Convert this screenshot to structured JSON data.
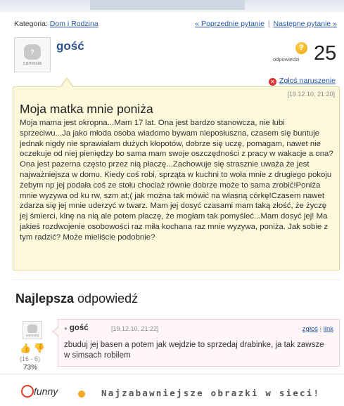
{
  "breadcrumb": {
    "prefix": "Kategoria:",
    "category": "Dom i Rodzina"
  },
  "nav": {
    "prev": "« Poprzednie pytanie",
    "separator": "|",
    "next": "Następne pytanie »"
  },
  "question": {
    "avatar_label": "samosia",
    "author": "gość",
    "answers_label": "odpowiedzi",
    "answers_count": "25",
    "report_label": "Zgłoś naruszenie",
    "date": "[19.12.10, 21:20]",
    "title": "Moja matka mnie poniża",
    "body": "Moja mama jest okropna...Mam 17 lat. Ona jest bardzo stanowcza, nie lubi sprzeciwu...Ja jako młoda osoba wiadomo bywam nieposłuszna, czasem się buntuje jednak nigdy nie sprawiałam dużych kłopotów, dobrze się uczę, pomagam, nawet nie oczekuje od niej pieniędzy bo sama mam swoje oszczędności z pracy w wakacje a ona? Ona jest pazerna często przez nią płaczę...Zachowuje się strasznie uważa że jest najważniejsza w domu. Kiedy coś robi, sprząta w kuchni to woła mnie z drugiego pokoju żebym np jej podała coś ze stołu chociaż równie dobrze może to sama zrobić!Poniża mnie wyzywa od ku rw, szm at;( jak można tak mówić na własną córkę!Czasem nawet zdarza się jej mnie uderzyć w twarz. Mam jej dosyć czasami mam taką złość, że życzę jej śmierci, klnę na nią ale potem płaczę, że mogłam tak pomyśleć...Mam dosyć jej! Ma jakieś rozdwojenie osobowości raz miła kochana raz mnie wyzywa, poniża. Jak sobie z tym radzić? Może mieliście podobnie?"
  },
  "best_answer": {
    "heading_bold": "Najlepsza",
    "heading_rest": " odpowiedź",
    "avatar_label": "samosia",
    "votes": "(16 - 6)",
    "percent": "73%",
    "author": "gość",
    "date": "[19.12.10, 21:22]",
    "report_link": "zgłoś",
    "link_sep": "|",
    "link_link": "link",
    "text": "zbuduj jej basen a potem jak wejdzie to sprzedaj drabinke, ja tak zawsze w simsach robilem"
  },
  "footer": {
    "logo_text": "funny",
    "slogan": "Najzabawniejsze obrazki w sieci!"
  }
}
